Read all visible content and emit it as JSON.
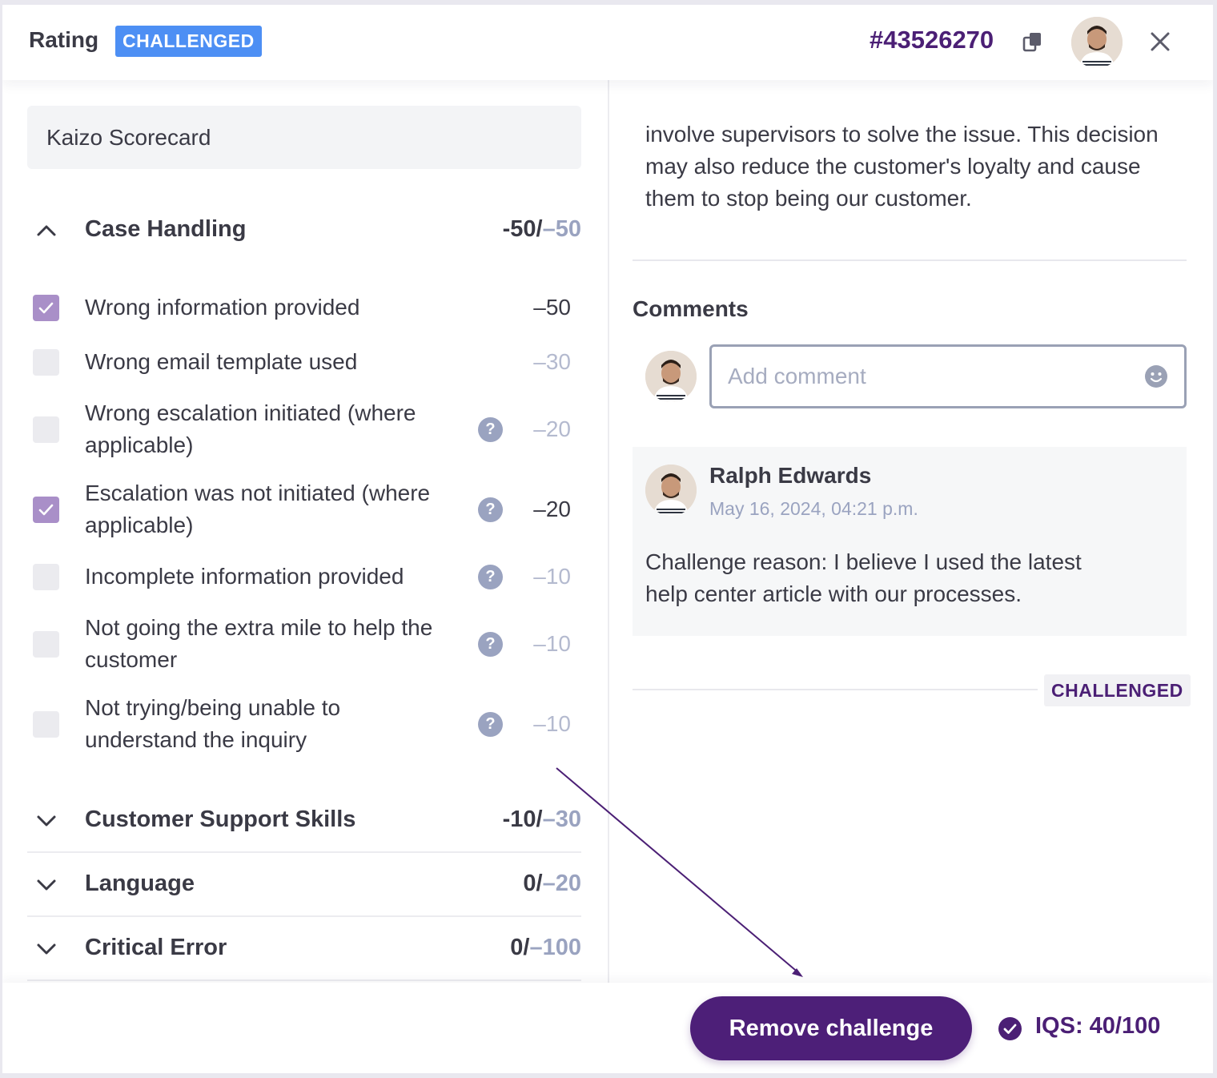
{
  "header": {
    "title": "Rating",
    "status_badge": "CHALLENGED",
    "ticket_id": "#43526270"
  },
  "scorecard": {
    "name": "Kaizo Scorecard"
  },
  "sections": {
    "case_handling": {
      "name": "Case Handling",
      "score": "-50/",
      "max": "–50",
      "expanded": true,
      "items": [
        {
          "label": "Wrong information provided",
          "points": "–50",
          "checked": true,
          "has_help": false
        },
        {
          "label": "Wrong email template used",
          "points": "–30",
          "checked": false,
          "has_help": false
        },
        {
          "label": "Wrong escalation initiated (where applicable)",
          "points": "–20",
          "checked": false,
          "has_help": true
        },
        {
          "label": "Escalation was not initiated (where applicable)",
          "points": "–20",
          "checked": true,
          "has_help": true
        },
        {
          "label": "Incomplete information provided",
          "points": "–10",
          "checked": false,
          "has_help": true
        },
        {
          "label": "Not going the extra mile to help the customer",
          "points": "–10",
          "checked": false,
          "has_help": true
        },
        {
          "label": "Not trying/being unable to understand the inquiry",
          "points": "–10",
          "checked": false,
          "has_help": true
        }
      ]
    },
    "customer_support": {
      "name": "Customer Support Skills",
      "score": "-10/",
      "max": "–30"
    },
    "language": {
      "name": "Language",
      "score": "0/",
      "max": "–20"
    },
    "critical_error": {
      "name": "Critical Error",
      "score": "0/",
      "max": "–100"
    }
  },
  "details": {
    "description": " involve supervisors to solve the issue. This decision may also reduce the customer's loyalty and cause them to stop being our customer."
  },
  "comments": {
    "title": "Comments",
    "input_placeholder": "Add comment",
    "entry": {
      "author": "Ralph Edwards",
      "time": "May 16, 2024, 04:21 p.m.",
      "text": "Challenge reason: I believe I used the latest help center article with our processes."
    },
    "status_badge": "CHALLENGED"
  },
  "footer": {
    "remove_button": "Remove challenge",
    "iqs": "IQS: 40/100"
  },
  "colors": {
    "accent_purple": "#4d1f78",
    "badge_blue": "#4d8ff4",
    "checkbox_checked": "#a98fc8",
    "muted": "#9aa3c0"
  },
  "icons": [
    "copy-icon",
    "close-icon",
    "chevron-up-icon",
    "chevron-down-icon",
    "check-icon",
    "help-icon",
    "emoji-icon",
    "check-circle-icon"
  ]
}
